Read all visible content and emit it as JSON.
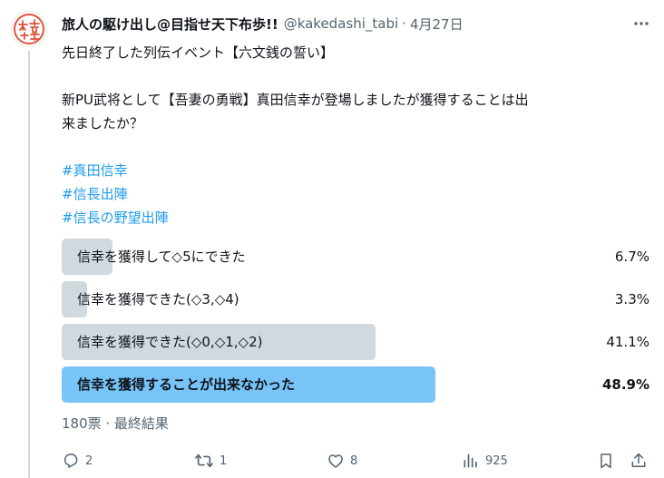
{
  "tweet": {
    "display_name": "旅人の駆け出し@目指せ天下布歩!!",
    "handle": "@kakedashi_tabi",
    "separator": "·",
    "date": "4月27日",
    "avatar_text": "布歩",
    "text_line1": "先日終了した列伝イベント【六文銭の誓い】",
    "text_line2": "新PU武将として【吾妻の勇戦】真田信幸が登場しましたが獲得することは出",
    "text_line3": "来ましたか？",
    "hashtags": [
      "#真田信幸",
      "#信長出陣",
      "#信長の野望出陣"
    ]
  },
  "poll": {
    "options": [
      {
        "label": "信幸を獲得して◇5にできた",
        "percent": "6.7%",
        "value": 6.7
      },
      {
        "label": "信幸を獲得できた(◇3,◇4)",
        "percent": "3.3%",
        "value": 3.3
      },
      {
        "label": "信幸を獲得できた(◇0,◇1,◇2)",
        "percent": "41.1%",
        "value": 41.1
      },
      {
        "label": "信幸を獲得することが出来なかった",
        "percent": "48.9%",
        "value": 48.9
      }
    ],
    "meta": "180票 · 最終結果"
  },
  "actions": {
    "reply_count": "2",
    "retweet_count": "1",
    "like_count": "8",
    "views_count": "925"
  },
  "colors": {
    "text": "#0f1419",
    "muted": "#536471",
    "link": "#1d9bf0",
    "poll_bar": "#cfd9de",
    "poll_winner": "#78c4f9",
    "avatar_accent": "#e0533d"
  },
  "icons": [
    "more-icon",
    "reply-icon",
    "retweet-icon",
    "like-icon",
    "views-icon",
    "bookmark-icon",
    "share-icon"
  ]
}
